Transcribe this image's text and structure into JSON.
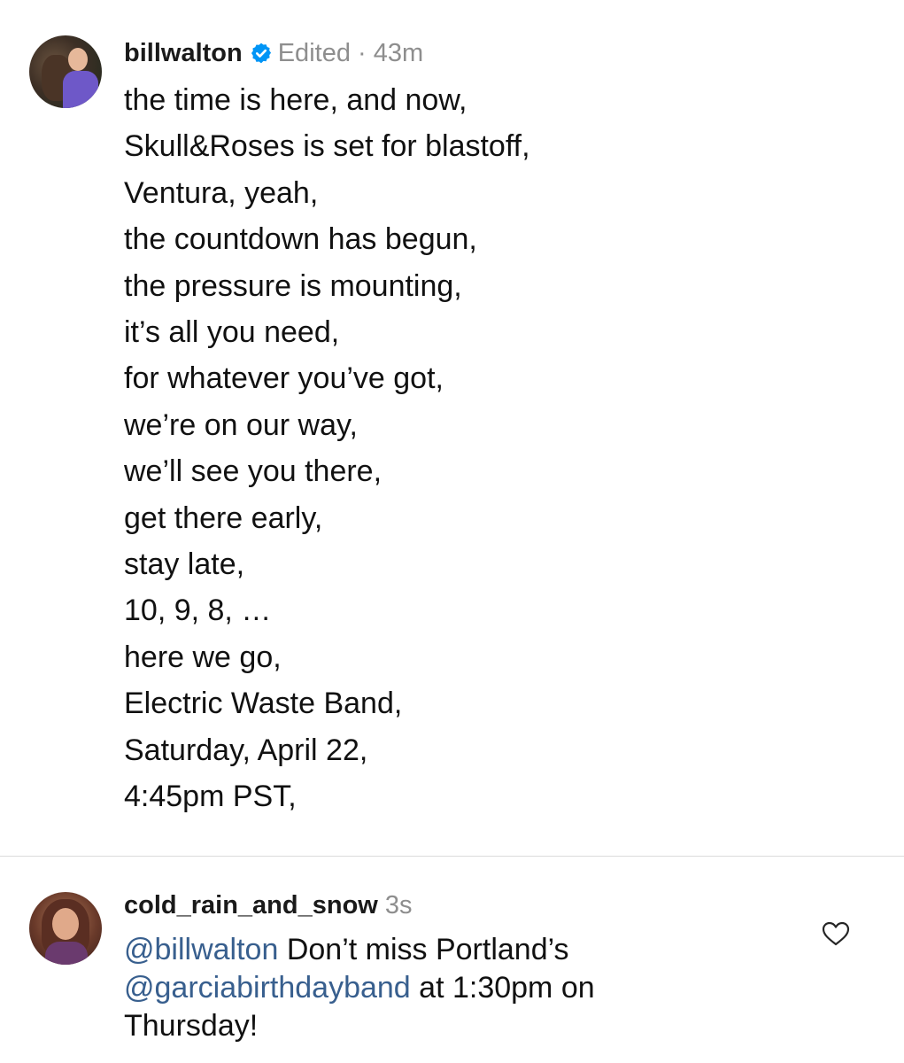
{
  "caption": {
    "username": "billwalton",
    "verified_icon": "verified-badge-icon",
    "edited": "Edited",
    "separator": "·",
    "time": "43m",
    "lines": [
      "the time is here, and now,",
      "Skull&Roses is set for blastoff,",
      "Ventura, yeah,",
      "the countdown has begun,",
      "the pressure is mounting,",
      "it’s all you need,",
      "for whatever you’ve got,",
      "we’re on our way,",
      "we’ll see you there,",
      "get there early,",
      "stay late,",
      "10, 9, 8, …",
      "here we go,",
      "Electric Waste Band,",
      "Saturday, April 22,",
      "4:45pm PST,"
    ]
  },
  "comment": {
    "username": "cold_rain_and_snow",
    "time": "3s",
    "mention_1": "@billwalton",
    "text_1": " Don’t miss Portland’s ",
    "mention_2": "@garciabirthdayband",
    "text_2": " at 1:30pm on Thursday!",
    "like_icon": "heart-icon"
  },
  "colors": {
    "verified_blue": "#0095f6",
    "mention_blue": "#385f8e",
    "muted_gray": "#8e8e8e",
    "divider": "#dbdbdb"
  }
}
